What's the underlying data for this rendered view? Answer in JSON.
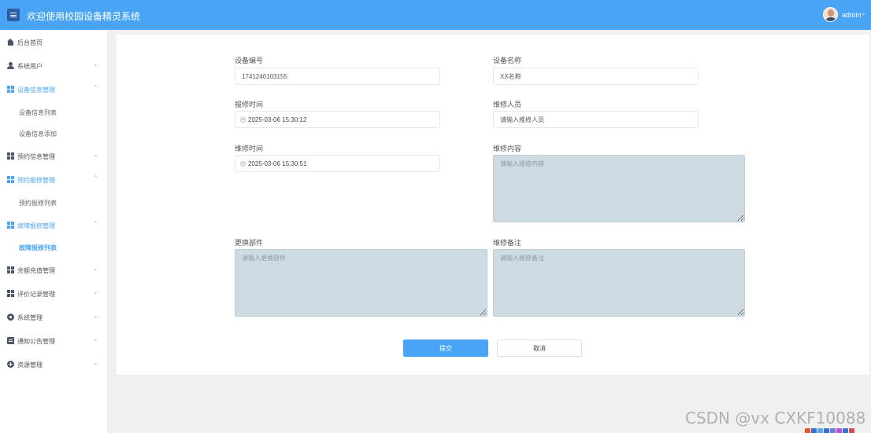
{
  "header": {
    "title": "欢迎使用校园设备精灵系统",
    "user": "admin",
    "accent": "#4aa4f6"
  },
  "sidebar": {
    "items": [
      {
        "label": "后台首页",
        "icon": "home-icon"
      },
      {
        "label": "系统用户",
        "icon": "user-icon"
      },
      {
        "label": "设备信息管理",
        "icon": "grid-icon"
      },
      {
        "label": "设备信息列表"
      },
      {
        "label": "设备信息添加"
      },
      {
        "label": "预约信息管理",
        "icon": "grid-icon"
      },
      {
        "label": "预约报修管理",
        "icon": "grid-icon"
      },
      {
        "label": "预约报修列表"
      },
      {
        "label": "故障报修管理",
        "icon": "grid-icon"
      },
      {
        "label": "故障报修列表"
      },
      {
        "label": "余额充值管理",
        "icon": "grid-icon"
      },
      {
        "label": "评价记录管理",
        "icon": "grid-icon"
      },
      {
        "label": "系统管理",
        "icon": "gear-icon"
      },
      {
        "label": "通知公告管理",
        "icon": "doc-icon"
      },
      {
        "label": "资源管理",
        "icon": "plus-circle-icon"
      }
    ]
  },
  "form": {
    "device_no": {
      "label": "设备编号",
      "value": "1741246103155"
    },
    "device_name": {
      "label": "设备名称",
      "value": "XX名称"
    },
    "report_time": {
      "label": "报修时间",
      "value": "2025-03-06 15:30:12"
    },
    "repairer": {
      "label": "维修人员",
      "value": "请输入维修人员"
    },
    "repair_time": {
      "label": "维修时间",
      "value": "2025-03-06 15:30:51"
    },
    "repair_content": {
      "label": "维修内容",
      "placeholder": "请输入维修内容"
    },
    "replaced_parts": {
      "label": "更换部件",
      "placeholder": "请输入更换部件"
    },
    "repair_remark": {
      "label": "维修备注",
      "placeholder": "请输入维修备注"
    },
    "submit_label": "提交",
    "cancel_label": "取消"
  },
  "watermark": "CSDN @vx  CXKF10088"
}
